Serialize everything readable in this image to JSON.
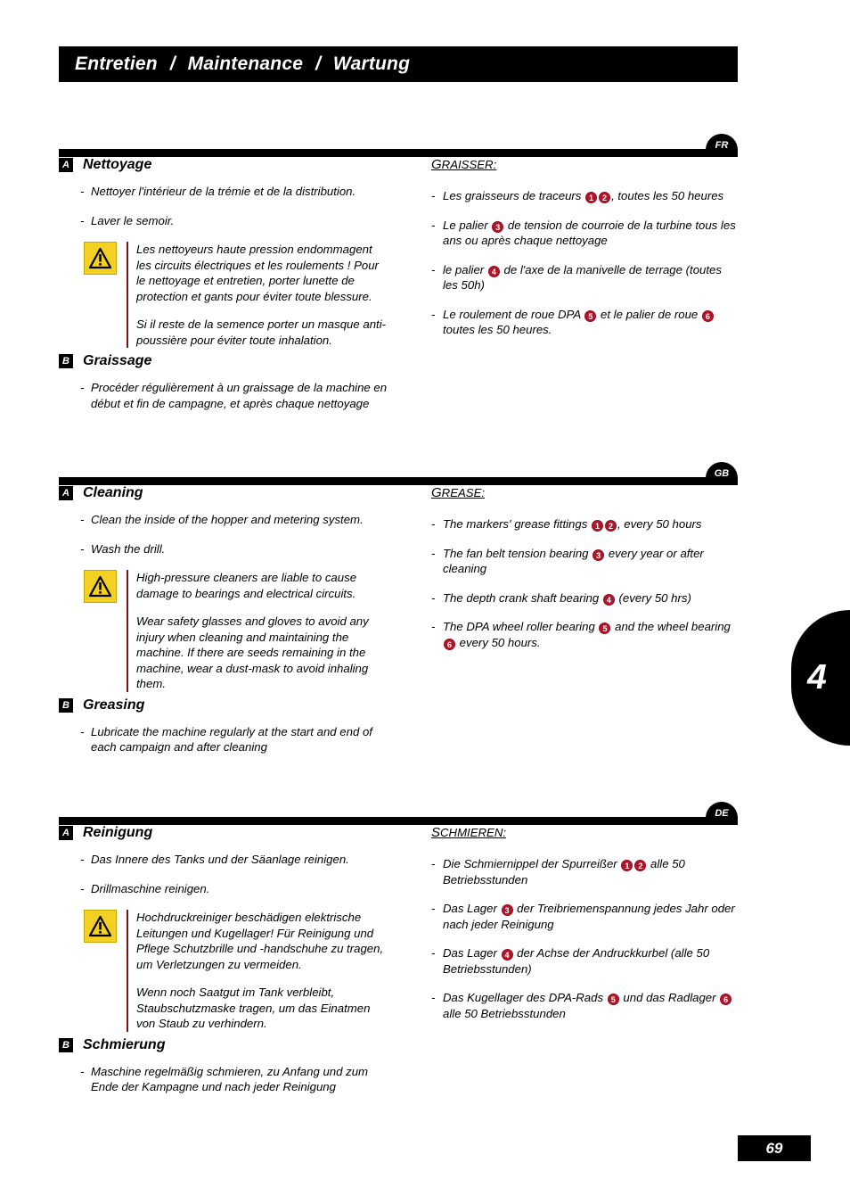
{
  "header": {
    "part1": "Entretien",
    "sep1": "/",
    "part2": "Maintenance",
    "sep2": "/",
    "part3": "Wartung"
  },
  "chapter_tab": "4",
  "page_number": "69",
  "warning_icon_name": "warning-triangle-icon",
  "colors": {
    "bar": "#000000",
    "warning_yellow": "#f2d024",
    "warning_rule": "#7d1010",
    "badge_red": "#b2152a"
  },
  "blocks": [
    {
      "id": "fr",
      "language_badge": "FR",
      "sections": [
        {
          "letter": "A",
          "title": "Nettoyage",
          "items": [
            "Nettoyer l'intérieur de la trémie et de la distribution.",
            "Laver le semoir."
          ],
          "warning": [
            "Les nettoyeurs haute pression endommagent les circuits électriques et les roulements ! Pour le nettoyage et entretien, porter lunette de protection et gants pour éviter toute blessure.",
            "Si il reste de la semence porter un masque anti-poussière pour éviter toute inhalation."
          ]
        },
        {
          "letter": "B",
          "title": "Graissage",
          "items": [
            "Procéder régulièrement à un graissage de la machine en début et fin de campagne, et après chaque nettoyage"
          ]
        }
      ],
      "right": {
        "heading_first": "G",
        "heading_rest": "RAISSER:",
        "items": [
          {
            "pre": "Les graisseurs de traceurs ",
            "nums": [
              "1",
              "2"
            ],
            "post": ", toutes les 50 heures"
          },
          {
            "pre": "Le palier ",
            "nums": [
              "3"
            ],
            "post": " de tension de courroie de la turbine tous les ans ou après chaque nettoyage"
          },
          {
            "pre": "le palier ",
            "nums": [
              "4"
            ],
            "post": " de l'axe de la manivelle de terrage (toutes les 50h)"
          },
          {
            "pre": "Le roulement de roue DPA ",
            "nums": [
              "5"
            ],
            "mid": " et le palier de roue ",
            "nums2": [
              "6"
            ],
            "post": " toutes les 50 heures."
          }
        ]
      }
    },
    {
      "id": "gb",
      "language_badge": "GB",
      "sections": [
        {
          "letter": "A",
          "title": "Cleaning",
          "items": [
            "Clean the inside of the hopper and metering system.",
            "Wash the drill."
          ],
          "warning": [
            "High-pressure cleaners are liable to cause damage to bearings and electrical circuits.",
            "Wear safety glasses and gloves to avoid any injury when cleaning and maintaining the machine. If there are seeds remaining in the machine, wear a dust-mask to avoid inhaling them."
          ]
        },
        {
          "letter": "B",
          "title": "Greasing",
          "items": [
            "Lubricate the machine regularly at the start and end of each campaign and after cleaning"
          ]
        }
      ],
      "right": {
        "heading_first": "G",
        "heading_rest": "REASE:",
        "items": [
          {
            "pre": "The markers' grease fittings ",
            "nums": [
              "1",
              "2"
            ],
            "post": ", every 50 hours"
          },
          {
            "pre": "The fan belt tension bearing ",
            "nums": [
              "3"
            ],
            "post": " every year or after cleaning"
          },
          {
            "pre": "The depth crank shaft bearing ",
            "nums": [
              "4"
            ],
            "post": " (every 50 hrs)"
          },
          {
            "pre": "The DPA wheel roller bearing ",
            "nums": [
              "5"
            ],
            "mid": " and the wheel bearing ",
            "nums2": [
              "6"
            ],
            "post": " every 50 hours."
          }
        ]
      }
    },
    {
      "id": "de",
      "language_badge": "DE",
      "sections": [
        {
          "letter": "A",
          "title": "Reinigung",
          "items": [
            "Das Innere des Tanks und der Säanlage reinigen.",
            "Drillmaschine reinigen."
          ],
          "warning": [
            "Hochdruckreiniger beschädigen elektrische Leitungen und Kugellager! Für Reinigung und Pflege Schutzbrille und -handschuhe zu tragen, um Verletzungen zu vermeiden.",
            "Wenn noch Saatgut im Tank verbleibt, Staubschutzmaske tragen, um das Einatmen von Staub zu verhindern."
          ]
        },
        {
          "letter": "B",
          "title": "Schmierung",
          "items": [
            "Maschine regelmäßig schmieren, zu Anfang und zum Ende der Kampagne und nach jeder Reinigung"
          ]
        }
      ],
      "right": {
        "heading_first": "S",
        "heading_rest": "CHMIEREN:",
        "items": [
          {
            "pre": "Die Schmiernippel der Spurreißer ",
            "nums": [
              "1",
              "2"
            ],
            "post": " alle 50 Betriebsstunden"
          },
          {
            "pre": "Das Lager ",
            "nums": [
              "3"
            ],
            "post": " der Treibriemenspannung jedes Jahr oder nach jeder Reinigung"
          },
          {
            "pre": "Das Lager ",
            "nums": [
              "4"
            ],
            "post": " der Achse der Andruckkurbel (alle 50 Betriebsstunden)"
          },
          {
            "pre": "Das Kugellager des DPA-Rads ",
            "nums": [
              "5"
            ],
            "mid": " und das Radlager ",
            "nums2": [
              "6"
            ],
            "post": " alle 50 Betriebsstunden"
          }
        ]
      }
    }
  ]
}
